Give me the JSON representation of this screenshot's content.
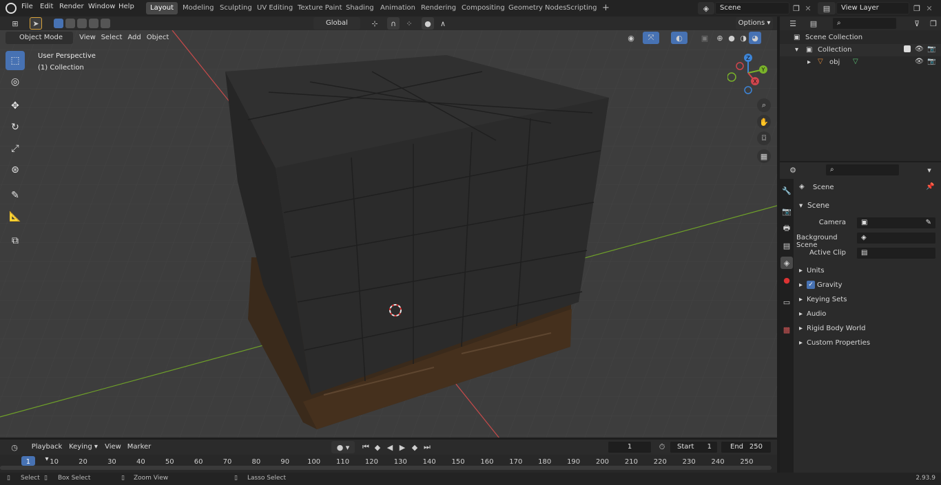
{
  "topbar": {
    "menus": [
      "File",
      "Edit",
      "Render",
      "Window",
      "Help"
    ],
    "workspaces": [
      "Layout",
      "Modeling",
      "Sculpting",
      "UV Editing",
      "Texture Paint",
      "Shading",
      "Animation",
      "Rendering",
      "Compositing",
      "Geometry Nodes",
      "Scripting"
    ],
    "active_workspace": "Layout",
    "scene_name": "Scene",
    "view_layer": "View Layer"
  },
  "viewport_header": {
    "mode": "Object Mode",
    "menus": [
      "View",
      "Select",
      "Add",
      "Object"
    ],
    "orientation": "Global",
    "options_label": "Options"
  },
  "viewport": {
    "perspective_label": "User Perspective",
    "collection_label": "(1) Collection",
    "gizmo_axes": [
      "X",
      "Y",
      "Z"
    ]
  },
  "outliner": {
    "root": "Scene Collection",
    "collection": "Collection",
    "object": "obj"
  },
  "properties": {
    "context_label": "Scene",
    "panel_title": "Scene",
    "fields": [
      {
        "label": "Camera",
        "value": ""
      },
      {
        "label": "Background Scene",
        "value": ""
      },
      {
        "label": "Active Clip",
        "value": ""
      }
    ],
    "subpanels": [
      "Units",
      "Gravity",
      "Keying Sets",
      "Audio",
      "Rigid Body World",
      "Custom Properties"
    ],
    "gravity_checked": true
  },
  "timeline": {
    "menus": [
      "Playback",
      "Keying",
      "View",
      "Marker"
    ],
    "current_frame": "1",
    "start_label": "Start",
    "start_value": "1",
    "end_label": "End",
    "end_value": "250",
    "ticks": [
      "1",
      "10",
      "20",
      "30",
      "40",
      "50",
      "60",
      "70",
      "80",
      "90",
      "100",
      "110",
      "120",
      "130",
      "140",
      "150",
      "160",
      "170",
      "180",
      "190",
      "200",
      "210",
      "220",
      "230",
      "240",
      "250"
    ]
  },
  "statusbar": {
    "select": "Select",
    "box_select": "Box Select",
    "zoom_view": "Zoom View",
    "lasso_select": "Lasso Select",
    "version": "2.93.9"
  },
  "colors": {
    "accent": "#4772b3",
    "viewport_bg": "#3e3e3e",
    "x_axis": "#d0454d",
    "y_axis": "#7ab32a",
    "z_axis": "#3d85d8"
  }
}
